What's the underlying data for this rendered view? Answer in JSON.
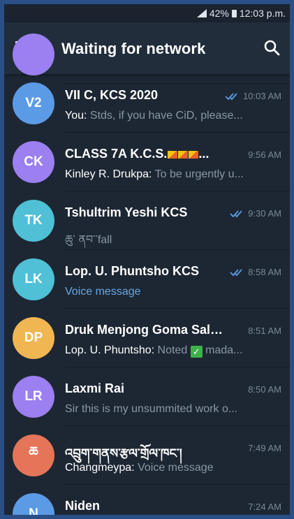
{
  "status_bar": {
    "battery": "42%",
    "time": "12:03 p.m."
  },
  "header": {
    "title": "Waiting for network",
    "menu_icon": "hamburger-menu-icon",
    "search_icon": "search-icon"
  },
  "chats": [
    {
      "initials": "V2",
      "color": "#5b9be6",
      "name": "VII C, KCS 2020",
      "time": "10:03 AM",
      "read": true,
      "sender": "You:",
      "message": "Stds, if you have CiD, please..."
    },
    {
      "initials": "CK",
      "color": "#9c7ff0",
      "name": "CLASS 7A K.C.S.",
      "time": "9:56 AM",
      "read": false,
      "sender": "Kinley R. Drukpa:",
      "message": "To be urgently u..."
    },
    {
      "initials": "TK",
      "color": "#4fc0d6",
      "name": "Tshultrim Yeshi KCS",
      "time": "9:30 AM",
      "read": true,
      "sender": "",
      "message": "ཆུ་ ནབ་་fall"
    },
    {
      "initials": "LK",
      "color": "#4fc0d6",
      "name": "Lop. U. Phuntsho KCS",
      "time": "8:58 AM",
      "read": true,
      "sender": "",
      "message": "Voice message"
    },
    {
      "initials": "DP",
      "color": "#f0b652",
      "name": "Druk Menjong Goma Sala...",
      "time": "8:51 AM",
      "read": false,
      "sender": "Lop. U. Phuntsho:",
      "message": "Noted",
      "message_after": "mada..."
    },
    {
      "initials": "LR",
      "color": "#9c7ff0",
      "name": "Laxmi Rai",
      "time": "8:50 AM",
      "read": false,
      "sender": "",
      "message": "Sir this is my  unsummited work o..."
    },
    {
      "initials": "ཆ",
      "color": "#e57558",
      "name": "འབྲུག་གནས་རྩལ་གྲོལ་ཁང་།",
      "time": "7:49 AM",
      "read": false,
      "sender": "Changmeypa:",
      "message": "Voice message"
    },
    {
      "initials": "N",
      "color": "#5b9be6",
      "name": "Niden",
      "time": "7:24 AM",
      "read": false,
      "sender": "",
      "message": ""
    }
  ]
}
